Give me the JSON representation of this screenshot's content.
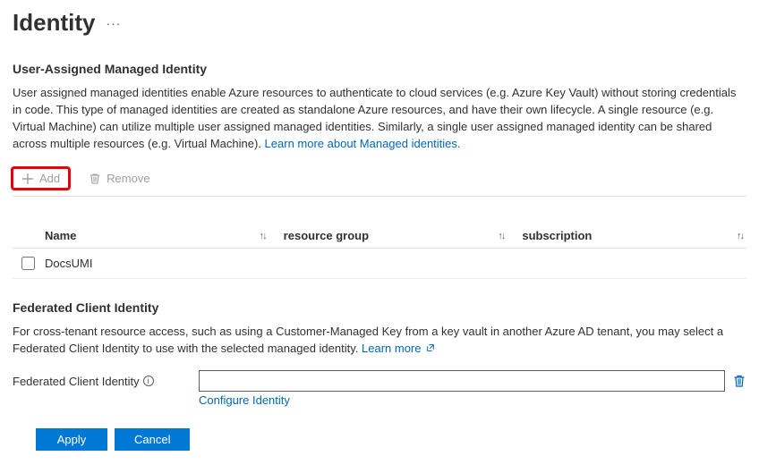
{
  "header": {
    "title": "Identity"
  },
  "uami": {
    "heading": "User-Assigned Managed Identity",
    "description_before_link": "User assigned managed identities enable Azure resources to authenticate to cloud services (e.g. Azure Key Vault) without storing credentials in code. This type of managed identities are created as standalone Azure resources, and have their own lifecycle. A single resource (e.g. Virtual Machine) can utilize multiple user assigned managed identities. Similarly, a single user assigned managed identity can be shared across multiple resources (e.g. Virtual Machine). ",
    "learn_link": "Learn more about Managed identities.",
    "toolbar": {
      "add": "Add",
      "remove": "Remove"
    },
    "columns": {
      "name": "Name",
      "resource_group": "resource group",
      "subscription": "subscription"
    },
    "rows": [
      {
        "name": "DocsUMI",
        "resource_group": "",
        "subscription": ""
      }
    ]
  },
  "fci": {
    "heading": "Federated Client Identity",
    "description_before_link": "For cross-tenant resource access, such as using a Customer-Managed Key from a key vault in another Azure AD tenant, you may select a Federated Client Identity to use with the selected managed identity. ",
    "learn_link": "Learn more",
    "field_label": "Federated Client Identity",
    "field_value": "",
    "configure_link": "Configure Identity"
  },
  "footer": {
    "apply": "Apply",
    "cancel": "Cancel"
  }
}
